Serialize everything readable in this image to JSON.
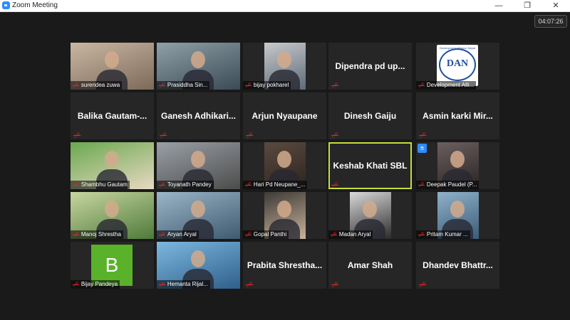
{
  "window": {
    "title": "Zoom Meeting",
    "minimize": "—",
    "restore": "❐",
    "close": "✕"
  },
  "meeting": {
    "timer": "04:07:26"
  },
  "participants": [
    {
      "name": "surendea zuwa",
      "type": "video"
    },
    {
      "name": "Prasiddha Sin...",
      "type": "video"
    },
    {
      "name": "bijay pokharel",
      "type": "video"
    },
    {
      "name": "Dipendra pd up...",
      "type": "name"
    },
    {
      "name": "Development Alli...",
      "type": "logo",
      "logo_text": "DAN",
      "logo_sub": "Development Alliance Nepal"
    },
    {
      "name": "Balika Gautam-...",
      "type": "name"
    },
    {
      "name": "Ganesh Adhikari...",
      "type": "name"
    },
    {
      "name": "Arjun Nyaupane",
      "type": "name"
    },
    {
      "name": "Dinesh Gaiju",
      "type": "name"
    },
    {
      "name": "Asmin karki Mir...",
      "type": "name"
    },
    {
      "name": "Shambhu Gautam",
      "type": "video"
    },
    {
      "name": "Toyanath Pandey",
      "type": "video"
    },
    {
      "name": "Hari Pd Neupane_...",
      "type": "video"
    },
    {
      "name": "Keshab Khati SBL",
      "type": "name",
      "active": true
    },
    {
      "name": "Deepak Paudel (P...",
      "type": "video",
      "hand": true
    },
    {
      "name": "Manoj Shrestha",
      "type": "video"
    },
    {
      "name": "Aryan Aryal",
      "type": "video"
    },
    {
      "name": "Gopal Panthi",
      "type": "video"
    },
    {
      "name": "Madan Aryal",
      "type": "video"
    },
    {
      "name": "Pritam Kumar ...",
      "type": "video"
    },
    {
      "name": "Bijay Pandeya",
      "type": "avatar",
      "initial": "B"
    },
    {
      "name": "Hemanta Rijal...",
      "type": "video"
    },
    {
      "name": "Prabita Shrestha...",
      "type": "name"
    },
    {
      "name": "Amar Shah",
      "type": "name"
    },
    {
      "name": "Dhandev Bhattr...",
      "type": "name"
    }
  ],
  "colors": {
    "active_border": "#c8dc3c",
    "muted_mic": "#e02828",
    "avatar_green": "#5ab12a",
    "accent": "#2d8cff"
  }
}
